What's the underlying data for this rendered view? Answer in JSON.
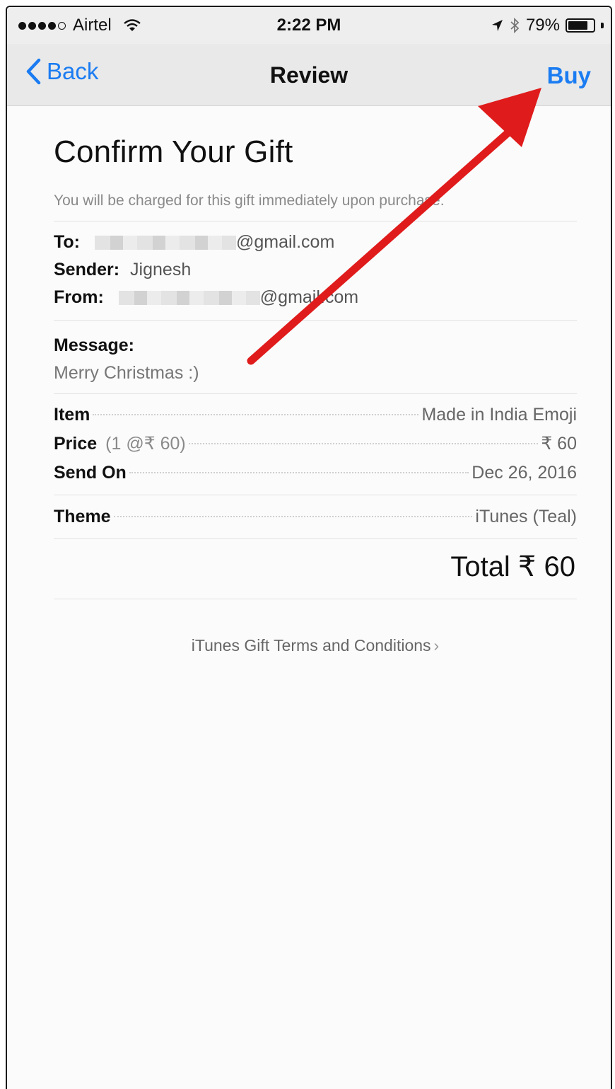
{
  "status_bar": {
    "carrier": "Airtel",
    "time": "2:22 PM",
    "battery": "79%",
    "battery_level": 0.79,
    "icons": [
      "signal-dots-icon",
      "wifi-icon",
      "location-arrow-icon",
      "bluetooth-icon",
      "battery-icon"
    ]
  },
  "nav": {
    "back_label": "Back",
    "title": "Review",
    "buy_label": "Buy"
  },
  "gift": {
    "heading": "Confirm Your Gift",
    "notice": "You will be charged for this gift immediately upon purchase.",
    "to_label": "To:",
    "to_value": "@gmail.com",
    "sender_label": "Sender:",
    "sender_value": "Jignesh",
    "from_label": "From:",
    "from_value": "@gmail.com",
    "message_label": "Message:",
    "message_value": "Merry Christmas :)"
  },
  "details": {
    "item_label": "Item",
    "item_value": "Made in India Emoji",
    "price_label": "Price",
    "price_sub": "(1 @₹ 60)",
    "price_value": "₹ 60",
    "send_on_label": "Send On",
    "send_on_value": "Dec 26, 2016",
    "theme_label": "Theme",
    "theme_value": "iTunes (Teal)"
  },
  "total": "Total ₹ 60",
  "terms_link": "iTunes Gift Terms and Conditions",
  "colors": {
    "accent": "#1b7cf2",
    "annotation_arrow": "#e01b1b"
  }
}
